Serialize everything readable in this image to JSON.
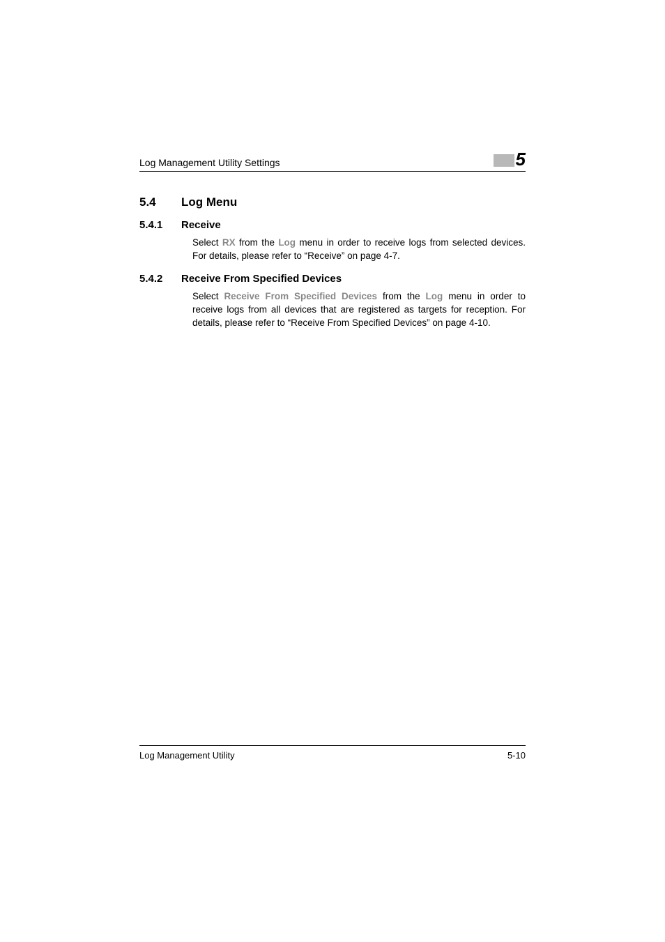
{
  "header": {
    "title": "Log Management Utility Settings",
    "chapter_number": "5"
  },
  "section": {
    "number": "5.4",
    "title": "Log Menu"
  },
  "subsections": [
    {
      "number": "5.4.1",
      "title": "Receive",
      "body_pre": "Select ",
      "bold1": "RX",
      "body_mid": " from the ",
      "bold2": "Log",
      "body_post": " menu in order to receive logs from selected devices. For details, please refer to “Receive” on page 4-7."
    },
    {
      "number": "5.4.2",
      "title": "Receive From Specified Devices",
      "body_pre": "Select ",
      "bold1": "Receive From Specified Devices",
      "body_mid": " from the ",
      "bold2": "Log",
      "body_post": " menu in order to receive logs from all devices that are registered as targets for reception. For details, please refer to “Receive From Specified Devices” on page 4-10."
    }
  ],
  "footer": {
    "left": "Log Management Utility",
    "right": "5-10"
  }
}
